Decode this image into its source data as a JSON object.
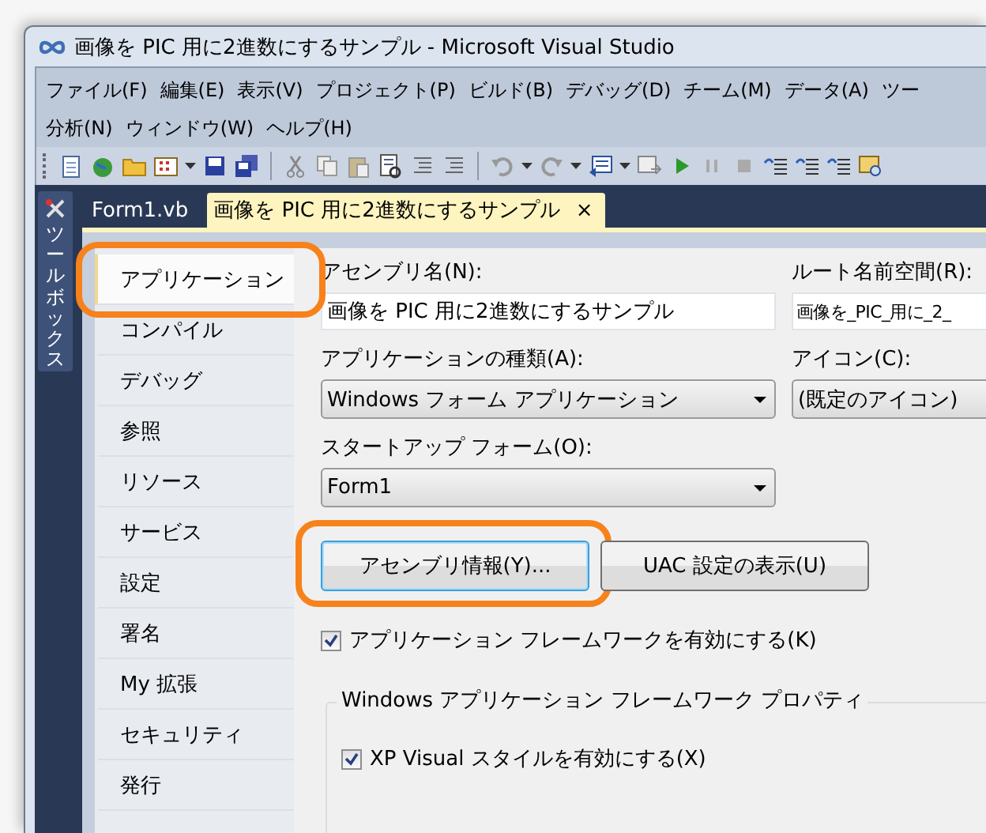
{
  "window": {
    "title": "画像を PIC 用に2進数にするサンプル - Microsoft Visual Studio"
  },
  "menu_rows": [
    {
      "items": [
        "ファイル(F)",
        "編集(E)",
        "表示(V)",
        "プロジェクト(P)",
        "ビルド(B)",
        "デバッグ(D)",
        "チーム(M)",
        "データ(A)",
        "ツー"
      ]
    },
    {
      "items": [
        "分析(N)",
        "ウィンドウ(W)",
        "ヘルプ(H)"
      ]
    }
  ],
  "toolbox": {
    "label": "ツールボックス"
  },
  "tabs": [
    {
      "label": "Form1.vb",
      "selected": false
    },
    {
      "label": "画像を PIC 用に2進数にするサンプル",
      "selected": true,
      "close": "×"
    }
  ],
  "nav": [
    {
      "label": "アプリケーション",
      "selected": true,
      "highlighted": true
    },
    {
      "label": "コンパイル",
      "selected": false,
      "highlighted": false
    },
    {
      "label": "デバッグ",
      "selected": false,
      "highlighted": false
    },
    {
      "label": "参照",
      "selected": false,
      "highlighted": false
    },
    {
      "label": "リソース",
      "selected": false,
      "highlighted": false
    },
    {
      "label": "サービス",
      "selected": false,
      "highlighted": false
    },
    {
      "label": "設定",
      "selected": false,
      "highlighted": false
    },
    {
      "label": "署名",
      "selected": false,
      "highlighted": false
    },
    {
      "label": "My 拡張",
      "selected": false,
      "highlighted": false
    },
    {
      "label": "セキュリティ",
      "selected": false,
      "highlighted": false
    },
    {
      "label": "発行",
      "selected": false,
      "highlighted": false
    }
  ],
  "fields": [
    {
      "kind": "text",
      "label": "アセンブリ名(N):",
      "value": "画像を PIC 用に2進数にするサンプル"
    },
    {
      "kind": "text",
      "label": "ルート名前空間(R):",
      "value": "画像を_PIC_用に_2_"
    },
    {
      "kind": "select",
      "label": "アプリケーションの種類(A):",
      "value": "Windows フォーム アプリケーション"
    },
    {
      "kind": "select",
      "label": "アイコン(C):",
      "value": "(既定のアイコン)"
    },
    {
      "kind": "select",
      "label": "スタートアップ フォーム(O):",
      "value": "Form1"
    }
  ],
  "buttons": [
    {
      "label": "アセンブリ情報(Y)...",
      "focused": true,
      "highlighted": true
    },
    {
      "label": "UAC 設定の表示(U)",
      "focused": false,
      "highlighted": false
    }
  ],
  "framework_checkbox": {
    "label": "アプリケーション フレームワークを有効にする(K)",
    "checked": true
  },
  "group": {
    "title": "Windows アプリケーション フレームワーク プロパティ",
    "checkboxes": [
      {
        "label": "XP Visual スタイルを有効にする(X)",
        "checked": true
      }
    ]
  }
}
